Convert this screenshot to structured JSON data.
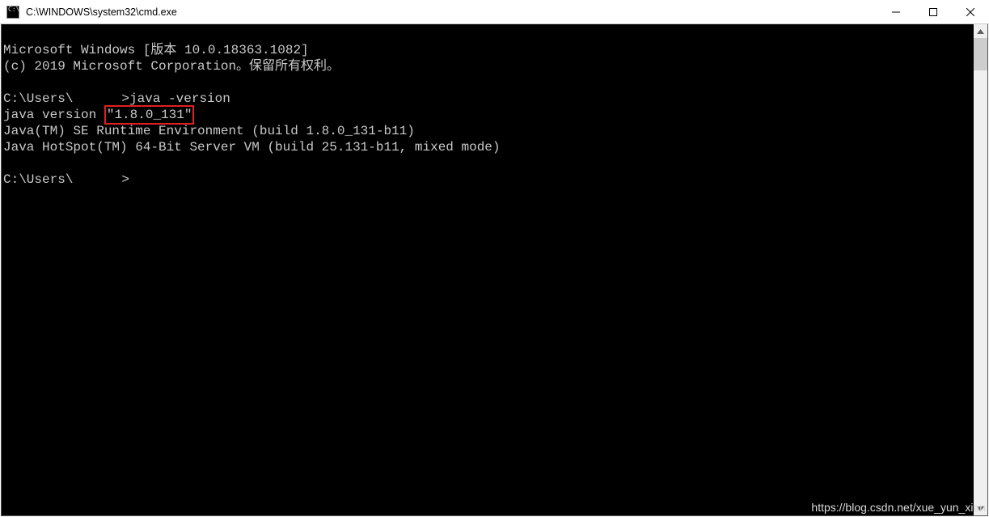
{
  "window": {
    "title": "C:\\WINDOWS\\system32\\cmd.exe"
  },
  "terminal": {
    "line1": "Microsoft Windows [版本 10.0.18363.1082]",
    "line2": "(c) 2019 Microsoft Corporation。保留所有权利。",
    "prompt1_prefix": "C:\\Users\\",
    "prompt1_suffix": ">",
    "command1": "java -version",
    "jv_line_prefix": "java version ",
    "jv_quote_open": "\"",
    "jv_version": "1.8.0_131",
    "jv_quote_close": "\"",
    "jre_line": "Java(TM) SE Runtime Environment (build 1.8.0_131-b11)",
    "hotspot_line": "Java HotSpot(TM) 64-Bit Server VM (build 25.131-b11, mixed mode)",
    "prompt2_prefix": "C:\\Users\\",
    "prompt2_suffix": ">"
  },
  "watermark": "https://blog.csdn.net/xue_yun_xian"
}
